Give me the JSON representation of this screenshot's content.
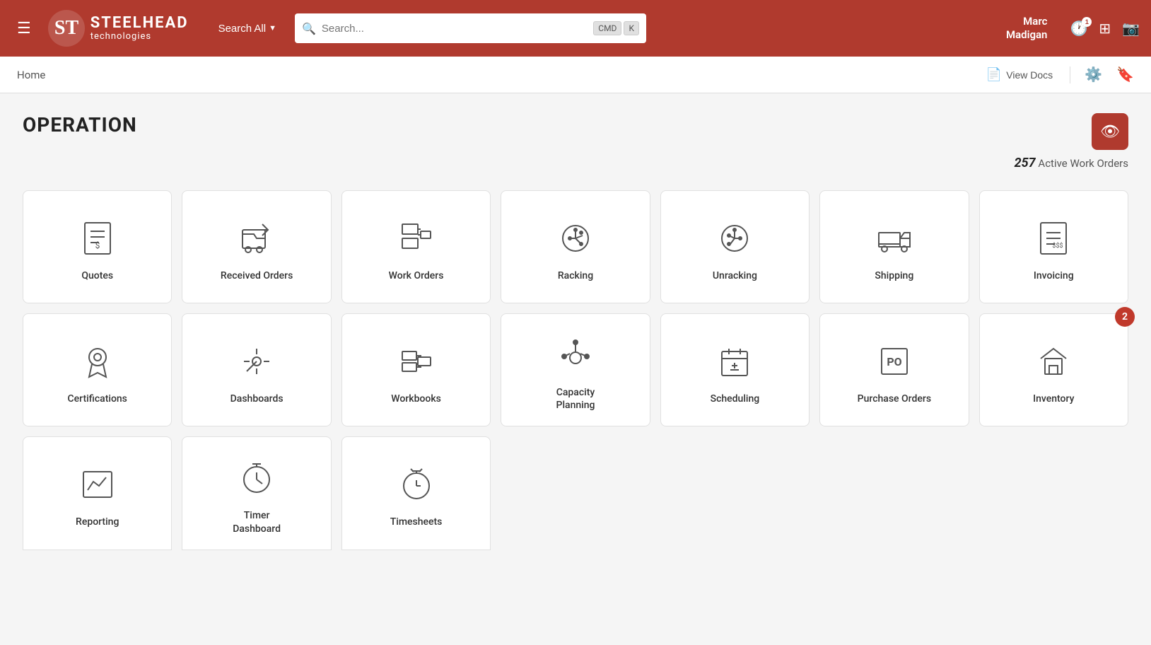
{
  "header": {
    "menu_label": "☰",
    "brand": "STEELHEAD",
    "sub": "technologies",
    "search_all_label": "Search All",
    "search_placeholder": "Search...",
    "kbd1": "CMD",
    "kbd2": "K",
    "user_name": "Marc\nMadigan",
    "clock_badge": "1",
    "view_docs_label": "View Docs"
  },
  "subnav": {
    "breadcrumb": "Home",
    "view_docs": "View Docs"
  },
  "section": {
    "title": "OPERATION",
    "active_count": "257",
    "active_label": "Active Work Orders"
  },
  "row1": [
    {
      "id": "quotes",
      "label": "Quotes"
    },
    {
      "id": "received-orders",
      "label": "Received Orders"
    },
    {
      "id": "work-orders",
      "label": "Work Orders"
    },
    {
      "id": "racking",
      "label": "Racking"
    },
    {
      "id": "unracking",
      "label": "Unracking"
    },
    {
      "id": "shipping",
      "label": "Shipping"
    },
    {
      "id": "invoicing",
      "label": "Invoicing"
    }
  ],
  "row2": [
    {
      "id": "certifications",
      "label": "Certifications",
      "badge": null
    },
    {
      "id": "dashboards",
      "label": "Dashboards",
      "badge": null
    },
    {
      "id": "workbooks",
      "label": "Workbooks",
      "badge": null
    },
    {
      "id": "capacity-planning",
      "label": "Capacity\nPlanning",
      "badge": null
    },
    {
      "id": "scheduling",
      "label": "Scheduling",
      "badge": null
    },
    {
      "id": "purchase-orders",
      "label": "Purchase Orders",
      "badge": null
    },
    {
      "id": "inventory",
      "label": "Inventory",
      "badge": "2"
    }
  ],
  "row3": [
    {
      "id": "reporting",
      "label": "Reporting"
    },
    {
      "id": "timer-dashboard",
      "label": "Timer\nDashboard"
    },
    {
      "id": "timesheets",
      "label": "Timesheets"
    }
  ]
}
